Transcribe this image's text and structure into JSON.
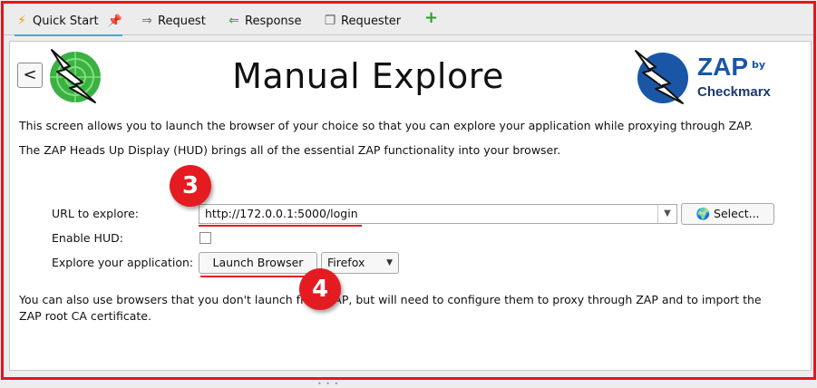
{
  "tabs": [
    {
      "label": "Quick Start",
      "icon": "lightning-icon"
    },
    {
      "label": "Request",
      "icon": "arrow-right-icon"
    },
    {
      "label": "Response",
      "icon": "arrow-left-icon"
    },
    {
      "label": "Requester",
      "icon": "requester-icon"
    }
  ],
  "add_tab_symbol": "+",
  "page": {
    "back_label": "<",
    "title": "Manual Explore",
    "logo_text": "ZAP",
    "logo_by": "by",
    "logo_company": "Checkmarx",
    "intro1": "This screen allows you to launch the browser of your choice so that you can explore your application while proxying through ZAP.",
    "intro2": "The ZAP Heads Up Display (HUD) brings all of the essential ZAP functionality into your browser.",
    "url_label": "URL to explore:",
    "url_value": "http://172.0.0.1:5000/login",
    "select_label": "Select...",
    "hud_label": "Enable HUD:",
    "hud_checked": false,
    "explore_label": "Explore your application:",
    "launch_label": "Launch Browser",
    "browser_value": "Firefox",
    "footer_line1": "You can also use browsers that you don't launch from ZAP, but will need to configure them to proxy through ZAP and to import the",
    "footer_line2": "ZAP root CA certificate."
  },
  "annotations": {
    "step3": "3",
    "step4": "4"
  },
  "colors": {
    "annotation": "#e51b22",
    "accent": "#4aa3df",
    "brand": "#1a56a6"
  }
}
